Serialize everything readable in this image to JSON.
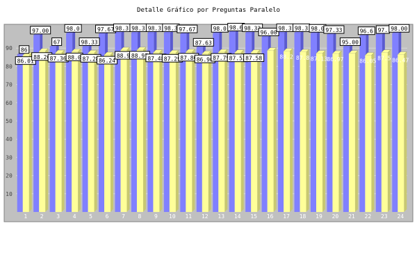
{
  "chart_data": {
    "type": "bar",
    "title": "Detalle Gráfico por Preguntas Paralelo",
    "xlabel": "",
    "ylabel": "",
    "ylim": [
      0,
      100
    ],
    "grid": true,
    "yticks": [
      10,
      20,
      30,
      40,
      50,
      60,
      70,
      80,
      90
    ],
    "categories": [
      "1",
      "2",
      "3",
      "4",
      "5",
      "6",
      "7",
      "8",
      "9",
      "10",
      "11",
      "12",
      "13",
      "14",
      "15",
      "16",
      "17",
      "18",
      "19",
      "20",
      "21",
      "22",
      "23",
      "24"
    ],
    "series": [
      {
        "values": [
          86.36,
          97.0,
          90.67,
          98.0,
          90.67,
          97.67,
          98.33,
          98.33,
          98.33,
          98.33,
          97.67,
          90.33,
          98.0,
          98.67,
          98.33,
          96.0,
          98.33,
          98.33,
          98.0,
          97.33,
          90.67,
          96.67,
          97.33,
          98.0
        ]
      },
      {
        "values": [
          86.01,
          88.26,
          87.36,
          88.01,
          87.28,
          86.24,
          88.91,
          88.97,
          87.48,
          87.29,
          87.86,
          86.9,
          87.79,
          87.52,
          87.58,
          88.67,
          88.28,
          87.81,
          87.13,
          86.97,
          87.08,
          86.05,
          87.53,
          86.47
        ]
      }
    ],
    "colors": {
      "series1": "#8080ff",
      "series2": "#ffff99",
      "plot_bg": "#c0c0c0",
      "grid": "#d8d8d8"
    },
    "label_texts_series1": [
      "86",
      "97.00",
      "67",
      "98.0",
      "98.33",
      "97.67",
      "98.3",
      "98.3",
      "98.3",
      "98.3",
      "97.67",
      "87.63",
      "98.0",
      "98.6",
      "98.33",
      "96.00",
      "98.3",
      "98.3",
      "98.0",
      "97.33",
      "95.00",
      "96.6",
      "97.",
      "98.00"
    ],
    "label_texts_series2": [
      "86.01",
      "88.26",
      "87.36",
      "88.0",
      "87.28",
      "86.24",
      "88.9",
      "88.97",
      "87.48",
      "87.29",
      "87.86",
      "86.90",
      "87.79",
      "87.52",
      "87.58",
      "",
      "88.2",
      "87.8",
      "87.13",
      "86.97",
      "",
      "86.05",
      "87.5",
      "86.47"
    ]
  }
}
